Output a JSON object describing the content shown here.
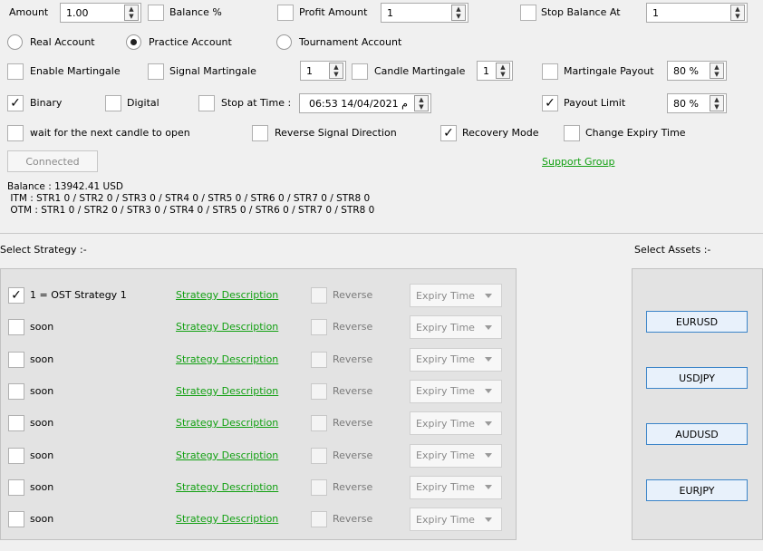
{
  "row1": {
    "amount_label": "Amount",
    "amount_value": "1.00",
    "balance_pct_label": "Balance %",
    "profit_amount_label": "Profit Amount",
    "profit_amount_value": "1",
    "stop_balance_label": "Stop Balance At",
    "stop_balance_value": "1"
  },
  "account_mode": {
    "real": "Real Account",
    "practice": "Practice Account",
    "tournament": "Tournament Account",
    "selected": "practice"
  },
  "row3": {
    "enable_martingale": "Enable Martingale",
    "signal_martingale": "Signal Martingale",
    "signal_martingale_value": "1",
    "candle_martingale": "Candle Martingale",
    "candle_martingale_value": "1",
    "martingale_payout": "Martingale Payout",
    "martingale_payout_value": "80 %"
  },
  "row4": {
    "binary": "Binary",
    "binary_checked": true,
    "digital": "Digital",
    "stop_at_time": "Stop at Time :",
    "stop_time_value": "06:53 14/04/2021 م",
    "payout_limit": "Payout Limit",
    "payout_limit_checked": true,
    "payout_limit_value": "80 %"
  },
  "row5": {
    "wait_next_candle": "wait for the next candle to open",
    "reverse_signal": "Reverse Signal Direction",
    "recovery_mode": "Recovery Mode",
    "recovery_checked": true,
    "change_expiry": "Change Expiry Time"
  },
  "connect_button": "Connected",
  "support_link": "Support Group",
  "info": {
    "balance": "Balance : 13942.41 USD",
    "itm": " ITM : STR1 0 / STR2 0 / STR3 0 / STR4 0 / STR5 0 / STR6 0 / STR7 0 / STR8 0",
    "otm": " OTM : STR1 0 / STR2 0 / STR3 0 / STR4 0 / STR5 0 / STR6 0 / STR7 0 / STR8 0"
  },
  "strategies": {
    "header": "Select Strategy :-",
    "rows": [
      {
        "name": "1 = OST Strategy 1",
        "checked": true
      },
      {
        "name": "soon",
        "checked": false
      },
      {
        "name": "soon",
        "checked": false
      },
      {
        "name": "soon",
        "checked": false
      },
      {
        "name": "soon",
        "checked": false
      },
      {
        "name": "soon",
        "checked": false
      },
      {
        "name": "soon",
        "checked": false
      },
      {
        "name": "soon",
        "checked": false
      }
    ],
    "description_label": "Strategy Description",
    "reverse_label": "Reverse",
    "expiry_label": "Expiry Time"
  },
  "assets": {
    "header": "Select Assets :-",
    "items": [
      "EURUSD",
      "USDJPY",
      "AUDUSD",
      "EURJPY"
    ]
  },
  "check_mark": "✓"
}
